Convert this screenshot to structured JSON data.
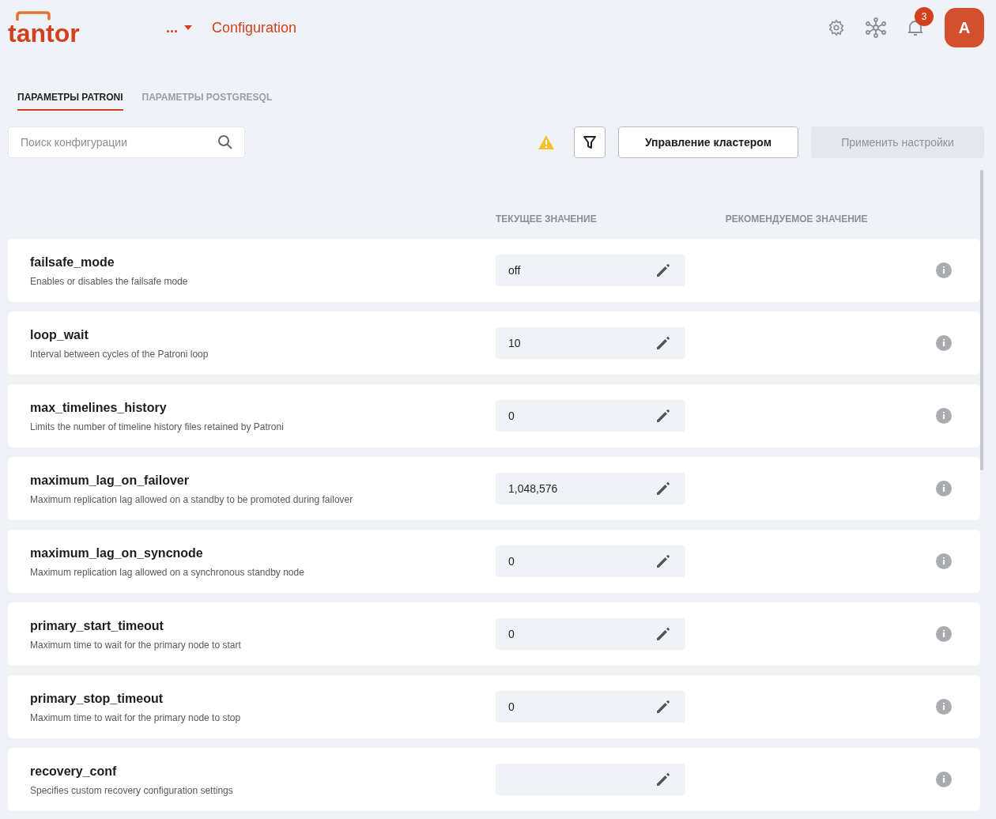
{
  "header": {
    "logo": "tantor",
    "breadcrumb_menu": "...",
    "title": "Configuration",
    "notifications_count": "3",
    "avatar": "A"
  },
  "tabs": [
    {
      "label": "ПАРАМЕТРЫ PATRONI",
      "selected": true
    },
    {
      "label": "ПАРАМЕТРЫ POSTGRESQL",
      "selected": false
    }
  ],
  "search": {
    "placeholder": "Поиск конфигурации"
  },
  "toolbar": {
    "warning": true,
    "buttons": [
      {
        "label": "Управление кластером",
        "disabled": false
      },
      {
        "label": "Применить настройки",
        "disabled": true
      }
    ]
  },
  "table": {
    "columns": [
      "ТЕКУЩЕЕ ЗНАЧЕНИЕ",
      "РЕКОМЕНДУЕМОЕ ЗНАЧЕНИЕ"
    ],
    "rows": [
      {
        "name": "failsafe_mode",
        "description": "Enables or disables the failsafe mode",
        "value": "off"
      },
      {
        "name": "loop_wait",
        "description": "Interval between cycles of the Patroni loop",
        "value": "10"
      },
      {
        "name": "max_timelines_history",
        "description": "Limits the number of timeline history files retained by Patroni",
        "value": "0"
      },
      {
        "name": "maximum_lag_on_failover",
        "description": "Maximum replication lag allowed on a standby to be promoted during failover",
        "value": "1,048,576"
      },
      {
        "name": "maximum_lag_on_syncnode",
        "description": "Maximum replication lag allowed on a synchronous standby node",
        "value": "0"
      },
      {
        "name": "primary_start_timeout",
        "description": "Maximum time to wait for the primary node to start",
        "value": "0"
      },
      {
        "name": "primary_stop_timeout",
        "description": "Maximum time to wait for the primary node to stop",
        "value": "0"
      },
      {
        "name": "recovery_conf",
        "description": "Specifies custom recovery configuration settings",
        "value": ""
      }
    ]
  }
}
